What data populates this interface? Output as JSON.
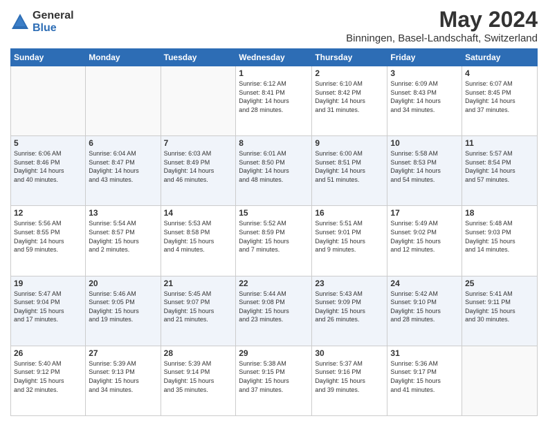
{
  "header": {
    "logo_general": "General",
    "logo_blue": "Blue",
    "title": "May 2024",
    "subtitle": "Binningen, Basel-Landschaft, Switzerland"
  },
  "weekdays": [
    "Sunday",
    "Monday",
    "Tuesday",
    "Wednesday",
    "Thursday",
    "Friday",
    "Saturday"
  ],
  "weeks": [
    [
      {
        "day": "",
        "info": ""
      },
      {
        "day": "",
        "info": ""
      },
      {
        "day": "",
        "info": ""
      },
      {
        "day": "1",
        "info": "Sunrise: 6:12 AM\nSunset: 8:41 PM\nDaylight: 14 hours\nand 28 minutes."
      },
      {
        "day": "2",
        "info": "Sunrise: 6:10 AM\nSunset: 8:42 PM\nDaylight: 14 hours\nand 31 minutes."
      },
      {
        "day": "3",
        "info": "Sunrise: 6:09 AM\nSunset: 8:43 PM\nDaylight: 14 hours\nand 34 minutes."
      },
      {
        "day": "4",
        "info": "Sunrise: 6:07 AM\nSunset: 8:45 PM\nDaylight: 14 hours\nand 37 minutes."
      }
    ],
    [
      {
        "day": "5",
        "info": "Sunrise: 6:06 AM\nSunset: 8:46 PM\nDaylight: 14 hours\nand 40 minutes."
      },
      {
        "day": "6",
        "info": "Sunrise: 6:04 AM\nSunset: 8:47 PM\nDaylight: 14 hours\nand 43 minutes."
      },
      {
        "day": "7",
        "info": "Sunrise: 6:03 AM\nSunset: 8:49 PM\nDaylight: 14 hours\nand 46 minutes."
      },
      {
        "day": "8",
        "info": "Sunrise: 6:01 AM\nSunset: 8:50 PM\nDaylight: 14 hours\nand 48 minutes."
      },
      {
        "day": "9",
        "info": "Sunrise: 6:00 AM\nSunset: 8:51 PM\nDaylight: 14 hours\nand 51 minutes."
      },
      {
        "day": "10",
        "info": "Sunrise: 5:58 AM\nSunset: 8:53 PM\nDaylight: 14 hours\nand 54 minutes."
      },
      {
        "day": "11",
        "info": "Sunrise: 5:57 AM\nSunset: 8:54 PM\nDaylight: 14 hours\nand 57 minutes."
      }
    ],
    [
      {
        "day": "12",
        "info": "Sunrise: 5:56 AM\nSunset: 8:55 PM\nDaylight: 14 hours\nand 59 minutes."
      },
      {
        "day": "13",
        "info": "Sunrise: 5:54 AM\nSunset: 8:57 PM\nDaylight: 15 hours\nand 2 minutes."
      },
      {
        "day": "14",
        "info": "Sunrise: 5:53 AM\nSunset: 8:58 PM\nDaylight: 15 hours\nand 4 minutes."
      },
      {
        "day": "15",
        "info": "Sunrise: 5:52 AM\nSunset: 8:59 PM\nDaylight: 15 hours\nand 7 minutes."
      },
      {
        "day": "16",
        "info": "Sunrise: 5:51 AM\nSunset: 9:01 PM\nDaylight: 15 hours\nand 9 minutes."
      },
      {
        "day": "17",
        "info": "Sunrise: 5:49 AM\nSunset: 9:02 PM\nDaylight: 15 hours\nand 12 minutes."
      },
      {
        "day": "18",
        "info": "Sunrise: 5:48 AM\nSunset: 9:03 PM\nDaylight: 15 hours\nand 14 minutes."
      }
    ],
    [
      {
        "day": "19",
        "info": "Sunrise: 5:47 AM\nSunset: 9:04 PM\nDaylight: 15 hours\nand 17 minutes."
      },
      {
        "day": "20",
        "info": "Sunrise: 5:46 AM\nSunset: 9:05 PM\nDaylight: 15 hours\nand 19 minutes."
      },
      {
        "day": "21",
        "info": "Sunrise: 5:45 AM\nSunset: 9:07 PM\nDaylight: 15 hours\nand 21 minutes."
      },
      {
        "day": "22",
        "info": "Sunrise: 5:44 AM\nSunset: 9:08 PM\nDaylight: 15 hours\nand 23 minutes."
      },
      {
        "day": "23",
        "info": "Sunrise: 5:43 AM\nSunset: 9:09 PM\nDaylight: 15 hours\nand 26 minutes."
      },
      {
        "day": "24",
        "info": "Sunrise: 5:42 AM\nSunset: 9:10 PM\nDaylight: 15 hours\nand 28 minutes."
      },
      {
        "day": "25",
        "info": "Sunrise: 5:41 AM\nSunset: 9:11 PM\nDaylight: 15 hours\nand 30 minutes."
      }
    ],
    [
      {
        "day": "26",
        "info": "Sunrise: 5:40 AM\nSunset: 9:12 PM\nDaylight: 15 hours\nand 32 minutes."
      },
      {
        "day": "27",
        "info": "Sunrise: 5:39 AM\nSunset: 9:13 PM\nDaylight: 15 hours\nand 34 minutes."
      },
      {
        "day": "28",
        "info": "Sunrise: 5:39 AM\nSunset: 9:14 PM\nDaylight: 15 hours\nand 35 minutes."
      },
      {
        "day": "29",
        "info": "Sunrise: 5:38 AM\nSunset: 9:15 PM\nDaylight: 15 hours\nand 37 minutes."
      },
      {
        "day": "30",
        "info": "Sunrise: 5:37 AM\nSunset: 9:16 PM\nDaylight: 15 hours\nand 39 minutes."
      },
      {
        "day": "31",
        "info": "Sunrise: 5:36 AM\nSunset: 9:17 PM\nDaylight: 15 hours\nand 41 minutes."
      },
      {
        "day": "",
        "info": ""
      }
    ]
  ]
}
